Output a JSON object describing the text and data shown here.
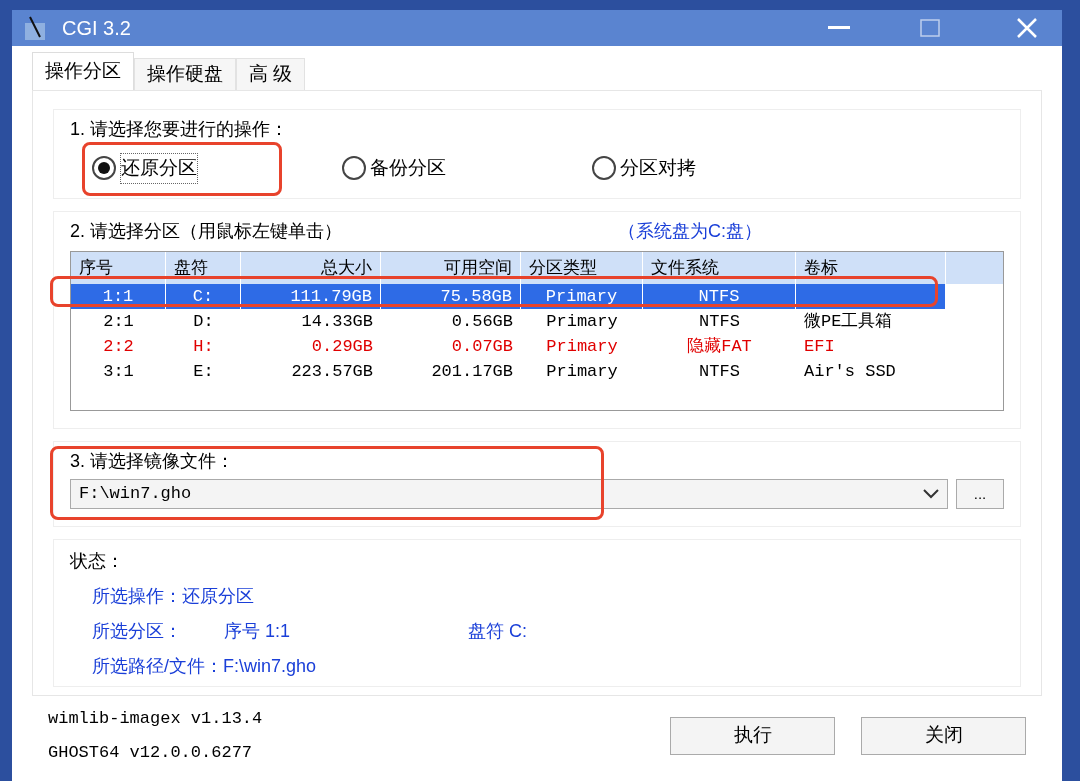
{
  "window": {
    "title": "CGI 3.2"
  },
  "tabs": [
    {
      "label": "操作分区",
      "selected": true
    },
    {
      "label": "操作硬盘",
      "selected": false
    },
    {
      "label": "高 级",
      "selected": false
    }
  ],
  "operation": {
    "heading": "1. 请选择您要进行的操作：",
    "options": [
      {
        "label": "还原分区",
        "selected": true
      },
      {
        "label": "备份分区",
        "selected": false
      },
      {
        "label": "分区对拷",
        "selected": false
      }
    ]
  },
  "partition": {
    "heading": "2. 请选择分区（用鼠标左键单击）",
    "system_note": "（系统盘为C:盘）",
    "columns": [
      "序号",
      "盘符",
      "总大小",
      "可用空间",
      "分区类型",
      "文件系统",
      "卷标"
    ],
    "rows": [
      {
        "cells": [
          "1:1",
          "C:",
          "111.79GB",
          "75.58GB",
          "Primary",
          "NTFS",
          ""
        ],
        "selected": true,
        "hidden": false
      },
      {
        "cells": [
          "2:1",
          "D:",
          "14.33GB",
          "0.56GB",
          "Primary",
          "NTFS",
          "微PE工具箱"
        ],
        "selected": false,
        "hidden": false
      },
      {
        "cells": [
          "2:2",
          "H:",
          "0.29GB",
          "0.07GB",
          "Primary",
          "隐藏FAT",
          "EFI"
        ],
        "selected": false,
        "hidden": true
      },
      {
        "cells": [
          "3:1",
          "E:",
          "223.57GB",
          "201.17GB",
          "Primary",
          "NTFS",
          "Air's SSD"
        ],
        "selected": false,
        "hidden": false
      }
    ]
  },
  "image": {
    "heading": "3. 请选择镜像文件：",
    "value": "F:\\win7.gho",
    "browse": "..."
  },
  "status": {
    "heading": "状态：",
    "lines": [
      [
        "所选操作：还原分区"
      ],
      [
        "所选分区：",
        "序号 1:1",
        "盘符 C:"
      ],
      [
        "所选路径/文件：F:\\win7.gho"
      ]
    ]
  },
  "versions": [
    "wimlib-imagex v1.13.4",
    "GHOST64 v12.0.0.6277"
  ],
  "buttons": [
    "执行",
    "关闭"
  ]
}
